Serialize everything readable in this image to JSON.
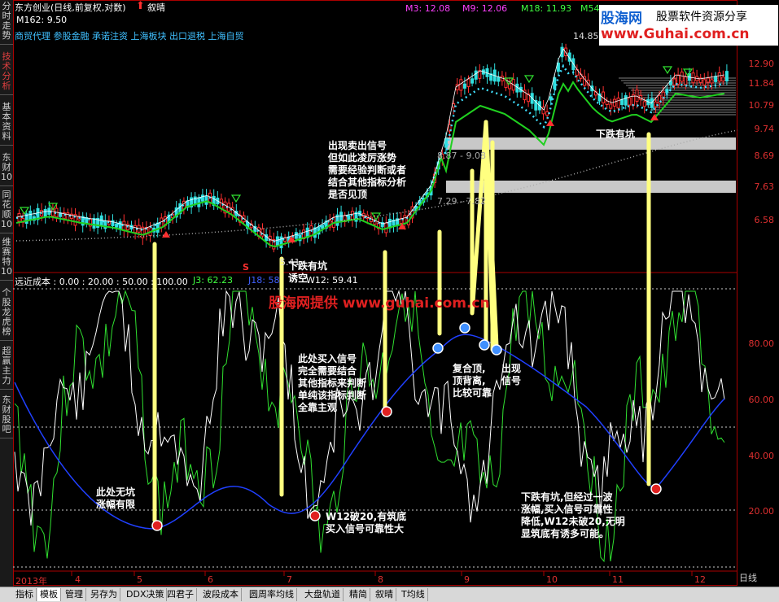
{
  "left_tabs": [
    {
      "label": "分时走势"
    },
    {
      "label": "技术分析"
    },
    {
      "label": "基本资料"
    },
    {
      "label": "东财10"
    },
    {
      "label": "同花顺10"
    },
    {
      "label": "维赛特10"
    },
    {
      "label": "个股龙虎榜"
    },
    {
      "label": "超赢主力"
    },
    {
      "label": "东财股吧"
    }
  ],
  "header": {
    "stock_title": "东方创业(日线,前复权,对数)",
    "arrow_icon": "red-up-arrow",
    "status_label": "叙晴",
    "m3": "M3: 12.08",
    "m9": "M9: 12.06",
    "m18": "M18: 11.93",
    "m54": "M54",
    "m162": "M162: 9.50",
    "concepts": "商贸代理  参股金融  承诺注资  上海板块  出口退税  上海自贸"
  },
  "watermark": {
    "brand": "股海网",
    "tagline": "股票软件资源分享",
    "url": "www.Guhai.com.cn",
    "center_text": "股海网提供  www.guhai.com.cn"
  },
  "price_axis": [
    "12.90",
    "11.84",
    "10.79",
    "9.74",
    "8.69",
    "7.63",
    "6.58"
  ],
  "price_labels": {
    "high": "14.85",
    "low": "5.41",
    "s_marker": "S",
    "band1": "8.87 - 9.08",
    "band2": "7.29 - 7.82"
  },
  "indicator_header": {
    "name": "远近成本 : 0.00 : 20.00 : 50.00 : 100.00",
    "j3": "J3: 62.23",
    "j18": "J18: 58",
    "w12": "W12: 59.41"
  },
  "indicator_axis": [
    "80.00",
    "60.00",
    "40.00",
    "20.00"
  ],
  "x_axis": {
    "year": "2013年",
    "months": [
      "4",
      "5",
      "6",
      "7",
      "8",
      "9",
      "10",
      "11",
      "12"
    ],
    "period": "日线"
  },
  "annotations": {
    "sell_signal": [
      "出现卖出信号",
      "但如此凌厉涨势",
      "需要经验判断或者",
      "结合其他指标分析",
      "是否见顶"
    ],
    "pit_trap": [
      "下跌有坑",
      "诱空"
    ],
    "pit_right": "下跌有坑",
    "buy_signal": [
      "此处买入信号",
      "完全需要结合",
      "其他指标来判断",
      "单纯该指标判断",
      "全靠主观"
    ],
    "top_divergence": [
      "复合顶,",
      "顶背离,",
      "比较可靠"
    ],
    "appear_signal": [
      "出现",
      "信号"
    ],
    "no_pit": [
      "此处无坑",
      "涨幅有限"
    ],
    "w12_break": [
      "W12破20,有筑底",
      "买入信号可靠性大"
    ],
    "right_note": [
      "下跌有坑,但经过一波",
      "涨幅,买入信号可靠性",
      "降低,W12未破20,无明",
      "显筑底有诱多可能。"
    ]
  },
  "bottom_tabs": [
    "指标",
    "模板",
    "管理",
    "另存为",
    "DDX决策",
    "四君子",
    "波段成本",
    "圆周率均线",
    "大盘轨道",
    "精简",
    "叙晴",
    "T均线"
  ],
  "colors": {
    "up": "#ff3030",
    "down": "#30e0e0",
    "ma_green": "#20d020",
    "annotation_bar": "#ffff80",
    "axis_red": "#e03030"
  }
}
